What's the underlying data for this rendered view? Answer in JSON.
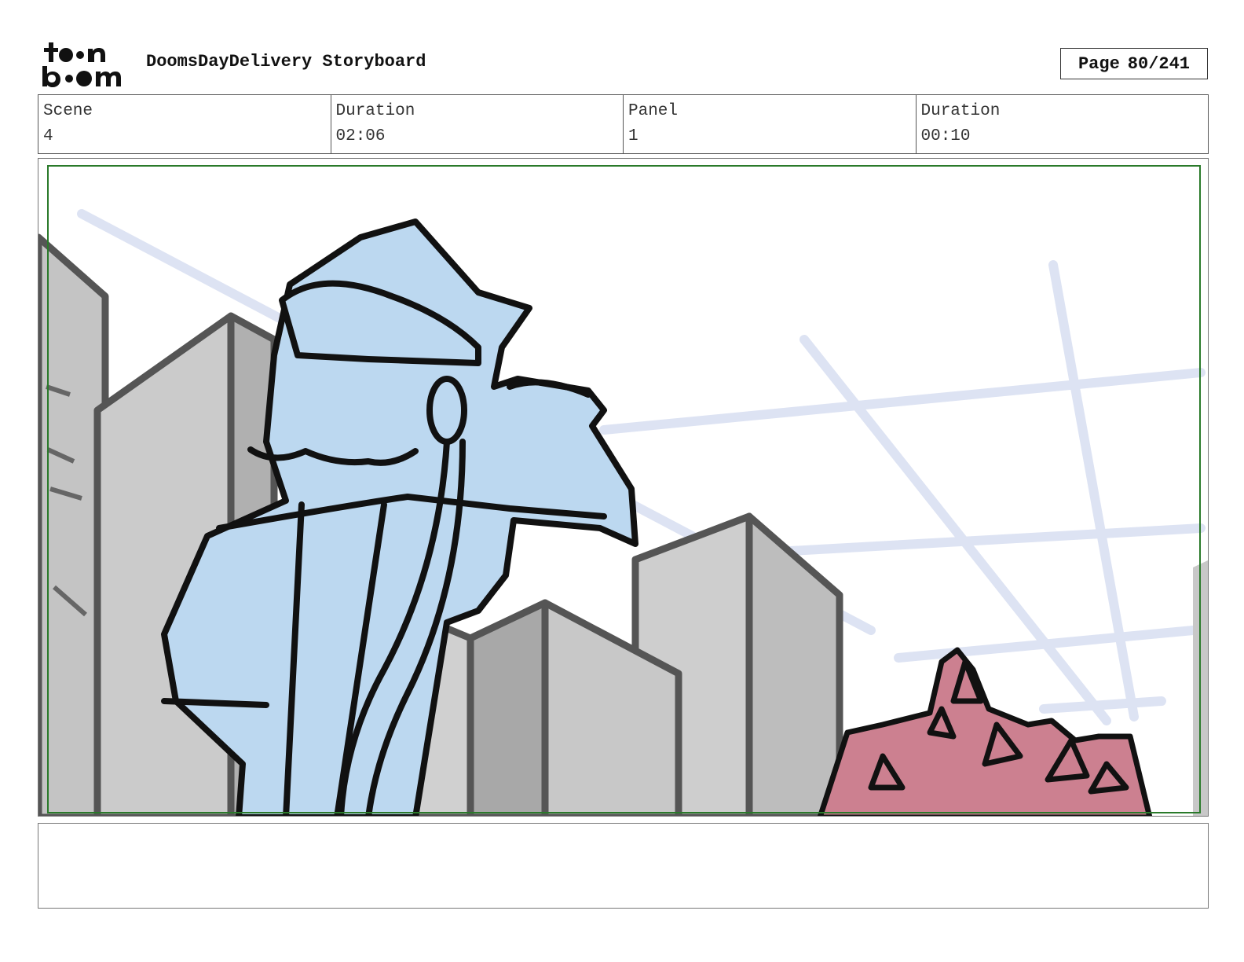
{
  "header": {
    "logo_text": "toonboom",
    "title": "DoomsDayDelivery Storyboard",
    "page_label": "Page",
    "page_value": "80/241"
  },
  "info": {
    "scene_label": "Scene",
    "scene_value": "4",
    "scene_duration_label": "Duration",
    "scene_duration_value": "02:06",
    "panel_label": "Panel",
    "panel_value": "1",
    "panel_duration_label": "Duration",
    "panel_duration_value": "00:10"
  },
  "notes": {
    "text": ""
  },
  "colors": {
    "safe_frame": "#2a7a2a",
    "character_fill": "#bcd8f0",
    "building_fill": "#c8c8c8",
    "monster_fill": "#cc8090",
    "sky_lines": "#dde3f3"
  }
}
